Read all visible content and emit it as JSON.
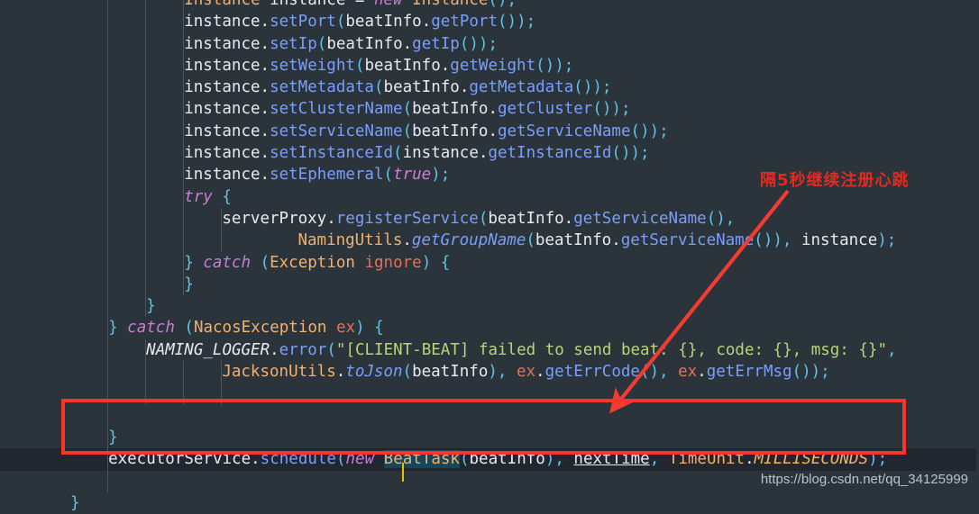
{
  "app": {
    "kind": "code-editor",
    "language": "Java",
    "theme_background": "#2b333b",
    "current_line_background": "#20272e"
  },
  "colors": {
    "annotation_red": "#e22b20",
    "box_red": "#f8352b",
    "arrow_red": "#f43b30",
    "string_green": "#b9d47a",
    "method_blue": "#7a9ffb",
    "keyword_purple": "#cb7dd4",
    "class_orange": "#f0b171",
    "param_salmon": "#e0715a",
    "punctuation_cyan": "#5ec4e8",
    "caret_yellow": "#f0c000",
    "occurrence_highlight": "#15475c"
  },
  "code": {
    "lines": [
      {
        "id": "l1",
        "indent": 12,
        "clipped_top": true,
        "tokens": [
          {
            "t": "Instance ",
            "c": "cls"
          },
          {
            "t": "instance",
            "c": "ident"
          },
          {
            "t": " = ",
            "c": "plain"
          },
          {
            "t": "new",
            "c": "kw"
          },
          {
            "t": " ",
            "c": "plain"
          },
          {
            "t": "Instance",
            "c": "cls"
          },
          {
            "t": "();",
            "c": "punc"
          }
        ]
      },
      {
        "id": "l2",
        "indent": 12,
        "tokens": [
          {
            "t": "instance",
            "c": "ident"
          },
          {
            "t": ".",
            "c": "plain"
          },
          {
            "t": "setPort",
            "c": "method"
          },
          {
            "t": "(",
            "c": "punc"
          },
          {
            "t": "beatInfo",
            "c": "ident"
          },
          {
            "t": ".",
            "c": "plain"
          },
          {
            "t": "getPort",
            "c": "method"
          },
          {
            "t": "());",
            "c": "punc"
          }
        ]
      },
      {
        "id": "l3",
        "indent": 12,
        "tokens": [
          {
            "t": "instance",
            "c": "ident"
          },
          {
            "t": ".",
            "c": "plain"
          },
          {
            "t": "setIp",
            "c": "method"
          },
          {
            "t": "(",
            "c": "punc"
          },
          {
            "t": "beatInfo",
            "c": "ident"
          },
          {
            "t": ".",
            "c": "plain"
          },
          {
            "t": "getIp",
            "c": "method"
          },
          {
            "t": "());",
            "c": "punc"
          }
        ]
      },
      {
        "id": "l4",
        "indent": 12,
        "tokens": [
          {
            "t": "instance",
            "c": "ident"
          },
          {
            "t": ".",
            "c": "plain"
          },
          {
            "t": "setWeight",
            "c": "method"
          },
          {
            "t": "(",
            "c": "punc"
          },
          {
            "t": "beatInfo",
            "c": "ident"
          },
          {
            "t": ".",
            "c": "plain"
          },
          {
            "t": "getWeight",
            "c": "method"
          },
          {
            "t": "());",
            "c": "punc"
          }
        ]
      },
      {
        "id": "l5",
        "indent": 12,
        "tokens": [
          {
            "t": "instance",
            "c": "ident"
          },
          {
            "t": ".",
            "c": "plain"
          },
          {
            "t": "setMetadata",
            "c": "method"
          },
          {
            "t": "(",
            "c": "punc"
          },
          {
            "t": "beatInfo",
            "c": "ident"
          },
          {
            "t": ".",
            "c": "plain"
          },
          {
            "t": "getMetadata",
            "c": "method"
          },
          {
            "t": "());",
            "c": "punc"
          }
        ]
      },
      {
        "id": "l6",
        "indent": 12,
        "tokens": [
          {
            "t": "instance",
            "c": "ident"
          },
          {
            "t": ".",
            "c": "plain"
          },
          {
            "t": "setClusterName",
            "c": "method"
          },
          {
            "t": "(",
            "c": "punc"
          },
          {
            "t": "beatInfo",
            "c": "ident"
          },
          {
            "t": ".",
            "c": "plain"
          },
          {
            "t": "getCluster",
            "c": "method"
          },
          {
            "t": "());",
            "c": "punc"
          }
        ]
      },
      {
        "id": "l7",
        "indent": 12,
        "tokens": [
          {
            "t": "instance",
            "c": "ident"
          },
          {
            "t": ".",
            "c": "plain"
          },
          {
            "t": "setServiceName",
            "c": "method"
          },
          {
            "t": "(",
            "c": "punc"
          },
          {
            "t": "beatInfo",
            "c": "ident"
          },
          {
            "t": ".",
            "c": "plain"
          },
          {
            "t": "getServiceName",
            "c": "method"
          },
          {
            "t": "());",
            "c": "punc"
          }
        ]
      },
      {
        "id": "l8",
        "indent": 12,
        "tokens": [
          {
            "t": "instance",
            "c": "ident"
          },
          {
            "t": ".",
            "c": "plain"
          },
          {
            "t": "setInstanceId",
            "c": "method"
          },
          {
            "t": "(",
            "c": "punc"
          },
          {
            "t": "instance",
            "c": "ident"
          },
          {
            "t": ".",
            "c": "plain"
          },
          {
            "t": "getInstanceId",
            "c": "method"
          },
          {
            "t": "());",
            "c": "punc"
          }
        ]
      },
      {
        "id": "l9",
        "indent": 12,
        "tokens": [
          {
            "t": "instance",
            "c": "ident"
          },
          {
            "t": ".",
            "c": "plain"
          },
          {
            "t": "setEphemeral",
            "c": "method"
          },
          {
            "t": "(",
            "c": "punc"
          },
          {
            "t": "true",
            "c": "kw"
          },
          {
            "t": ");",
            "c": "punc"
          }
        ]
      },
      {
        "id": "l10",
        "indent": 12,
        "tokens": [
          {
            "t": "try",
            "c": "kw"
          },
          {
            "t": " ",
            "c": "plain"
          },
          {
            "t": "{",
            "c": "punc"
          }
        ]
      },
      {
        "id": "l11",
        "indent": 16,
        "tokens": [
          {
            "t": "serverProxy",
            "c": "ident"
          },
          {
            "t": ".",
            "c": "plain"
          },
          {
            "t": "registerService",
            "c": "method"
          },
          {
            "t": "(",
            "c": "punc"
          },
          {
            "t": "beatInfo",
            "c": "ident"
          },
          {
            "t": ".",
            "c": "plain"
          },
          {
            "t": "getServiceName",
            "c": "method"
          },
          {
            "t": "(),",
            "c": "punc"
          }
        ]
      },
      {
        "id": "l12",
        "indent": 24,
        "tokens": [
          {
            "t": "NamingUtils",
            "c": "cls"
          },
          {
            "t": ".",
            "c": "plain"
          },
          {
            "t": "getGroupName",
            "c": "methodi"
          },
          {
            "t": "(",
            "c": "punc"
          },
          {
            "t": "beatInfo",
            "c": "ident"
          },
          {
            "t": ".",
            "c": "plain"
          },
          {
            "t": "getServiceName",
            "c": "method"
          },
          {
            "t": "()),",
            "c": "punc"
          },
          {
            "t": " instance",
            "c": "ident"
          },
          {
            "t": ");",
            "c": "punc"
          }
        ]
      },
      {
        "id": "l13",
        "indent": 12,
        "tokens": [
          {
            "t": "}",
            "c": "punc"
          },
          {
            "t": " ",
            "c": "plain"
          },
          {
            "t": "catch",
            "c": "kw"
          },
          {
            "t": " ",
            "c": "plain"
          },
          {
            "t": "(",
            "c": "punc"
          },
          {
            "t": "Exception",
            "c": "cls"
          },
          {
            "t": " ",
            "c": "plain"
          },
          {
            "t": "ignore",
            "c": "param"
          },
          {
            "t": ") {",
            "c": "punc"
          }
        ]
      },
      {
        "id": "l14",
        "indent": 12,
        "tokens": [
          {
            "t": "}",
            "c": "punc"
          }
        ]
      },
      {
        "id": "l15",
        "indent": 8,
        "tokens": [
          {
            "t": "}",
            "c": "punc"
          }
        ]
      },
      {
        "id": "l16",
        "indent": 4,
        "tokens": [
          {
            "t": "}",
            "c": "punc"
          },
          {
            "t": " ",
            "c": "plain"
          },
          {
            "t": "catch",
            "c": "kw"
          },
          {
            "t": " ",
            "c": "plain"
          },
          {
            "t": "(",
            "c": "punc"
          },
          {
            "t": "NacosException",
            "c": "cls"
          },
          {
            "t": " ",
            "c": "plain"
          },
          {
            "t": "ex",
            "c": "param"
          },
          {
            "t": ") {",
            "c": "punc"
          }
        ]
      },
      {
        "id": "l17",
        "indent": 8,
        "tokens": [
          {
            "t": "NAMING_LOGGER",
            "c": "staticf"
          },
          {
            "t": ".",
            "c": "plain"
          },
          {
            "t": "error",
            "c": "method"
          },
          {
            "t": "(",
            "c": "punc"
          },
          {
            "t": "\"[CLIENT-BEAT] failed to send beat: {}, code: {}, msg: {}\"",
            "c": "str"
          },
          {
            "t": ",",
            "c": "punc"
          }
        ]
      },
      {
        "id": "l18",
        "indent": 16,
        "tokens": [
          {
            "t": "JacksonUtils",
            "c": "cls"
          },
          {
            "t": ".",
            "c": "plain"
          },
          {
            "t": "toJson",
            "c": "methodi"
          },
          {
            "t": "(",
            "c": "punc"
          },
          {
            "t": "beatInfo",
            "c": "ident"
          },
          {
            "t": "), ",
            "c": "punc"
          },
          {
            "t": "ex",
            "c": "param"
          },
          {
            "t": ".",
            "c": "plain"
          },
          {
            "t": "getErrCode",
            "c": "method"
          },
          {
            "t": "(), ",
            "c": "punc"
          },
          {
            "t": "ex",
            "c": "param"
          },
          {
            "t": ".",
            "c": "plain"
          },
          {
            "t": "getErrMsg",
            "c": "method"
          },
          {
            "t": "());",
            "c": "punc"
          }
        ]
      },
      {
        "id": "l19",
        "indent": 0,
        "tokens": []
      },
      {
        "id": "l20",
        "indent": 0,
        "tokens": []
      },
      {
        "id": "l21",
        "indent": 4,
        "tokens": [
          {
            "t": "}",
            "c": "punc"
          }
        ]
      },
      {
        "id": "l22",
        "indent": 4,
        "current": true,
        "tokens": [
          {
            "t": "executorService",
            "c": "ident"
          },
          {
            "t": ".",
            "c": "plain"
          },
          {
            "t": "schedule",
            "c": "method"
          },
          {
            "t": "(",
            "c": "punc"
          },
          {
            "t": "new",
            "c": "kw"
          },
          {
            "t": " ",
            "c": "plain"
          },
          {
            "t": "Be",
            "c": "cls occ"
          },
          {
            "t": "",
            "c": "caret"
          },
          {
            "t": "atTask",
            "c": "cls occ"
          },
          {
            "t": "(",
            "c": "punc"
          },
          {
            "t": "beatInfo",
            "c": "ident"
          },
          {
            "t": "), ",
            "c": "punc"
          },
          {
            "t": "nextTime",
            "c": "ident under"
          },
          {
            "t": ", ",
            "c": "punc"
          },
          {
            "t": "TimeUnit",
            "c": "cls"
          },
          {
            "t": ".",
            "c": "plain"
          },
          {
            "t": "MILLISECONDS",
            "c": "clsi"
          },
          {
            "t": ");",
            "c": "punc"
          }
        ]
      },
      {
        "id": "l23",
        "indent": 0,
        "tokens": []
      },
      {
        "id": "l24",
        "indent": 0,
        "tokens": [
          {
            "t": "}",
            "c": "punc"
          }
        ]
      }
    ]
  },
  "annotations": {
    "note_text": "隔5秒继续注册心跳",
    "highlight_box": {
      "label": "highlight-rectangle"
    },
    "arrow": {
      "label": "pointer-arrow",
      "from": "note",
      "to": "highlighted-line"
    }
  },
  "watermark": {
    "text": "https://blog.csdn.net/qq_34125999"
  }
}
